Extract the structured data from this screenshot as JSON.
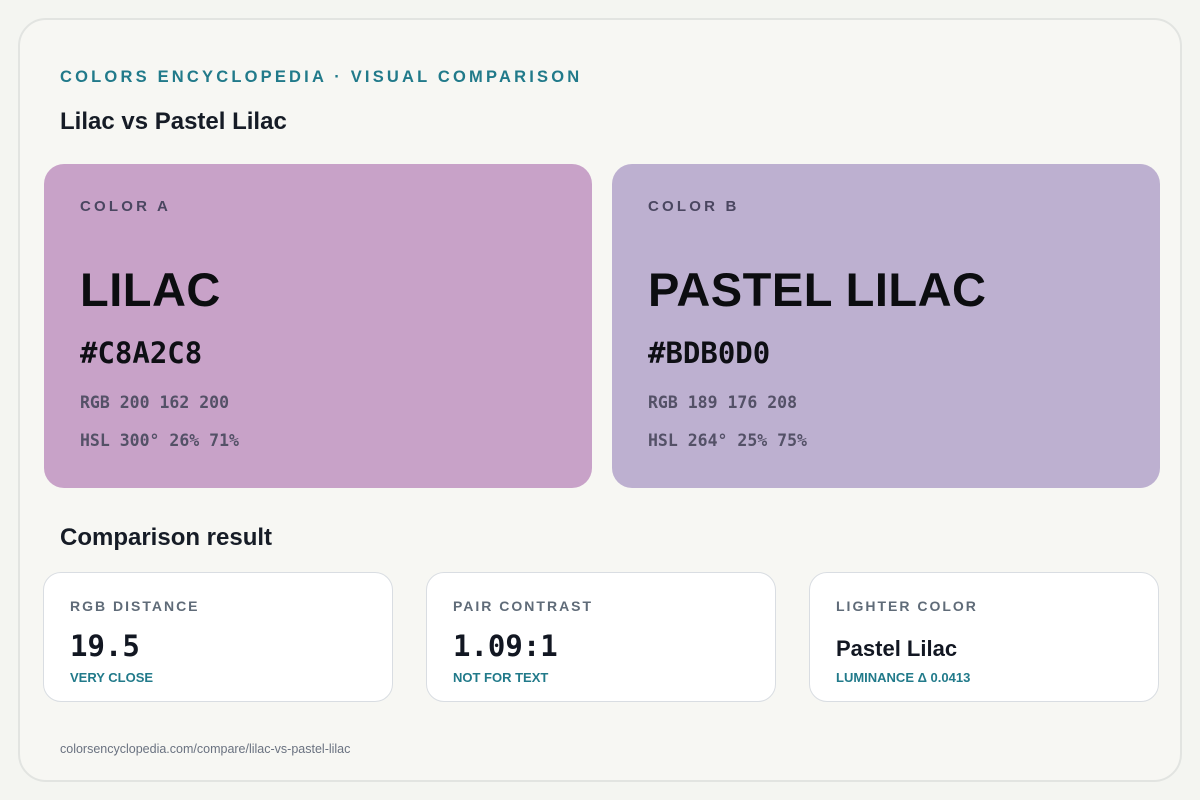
{
  "header": {
    "kicker": "COLORS ENCYCLOPEDIA · VISUAL COMPARISON",
    "title": "Lilac vs Pastel Lilac"
  },
  "colors": {
    "a": {
      "tag": "COLOR A",
      "name": "LILAC",
      "hex": "#C8A2C8",
      "rgb": "RGB 200 162 200",
      "hsl": "HSL 300° 26% 71%",
      "swatch_color": "#C8A2C8"
    },
    "b": {
      "tag": "COLOR B",
      "name": "PASTEL LILAC",
      "hex": "#BDB0D0",
      "rgb": "RGB 189 176 208",
      "hsl": "HSL 264° 25% 75%",
      "swatch_color": "#BDB0D0"
    }
  },
  "comparison": {
    "title": "Comparison result",
    "stats": [
      {
        "label": "RGB DISTANCE",
        "value": "19.5",
        "note": "VERY CLOSE"
      },
      {
        "label": "PAIR CONTRAST",
        "value": "1.09:1",
        "note": "NOT FOR TEXT"
      },
      {
        "label": "LIGHTER COLOR",
        "value": "Pastel Lilac",
        "note": "LUMINANCE Δ 0.0413"
      }
    ]
  },
  "footer": {
    "url": "colorsencyclopedia.com/compare/lilac-vs-pastel-lilac"
  },
  "theme": {
    "accent": "#217A8A",
    "background": "#F7F7F3"
  }
}
